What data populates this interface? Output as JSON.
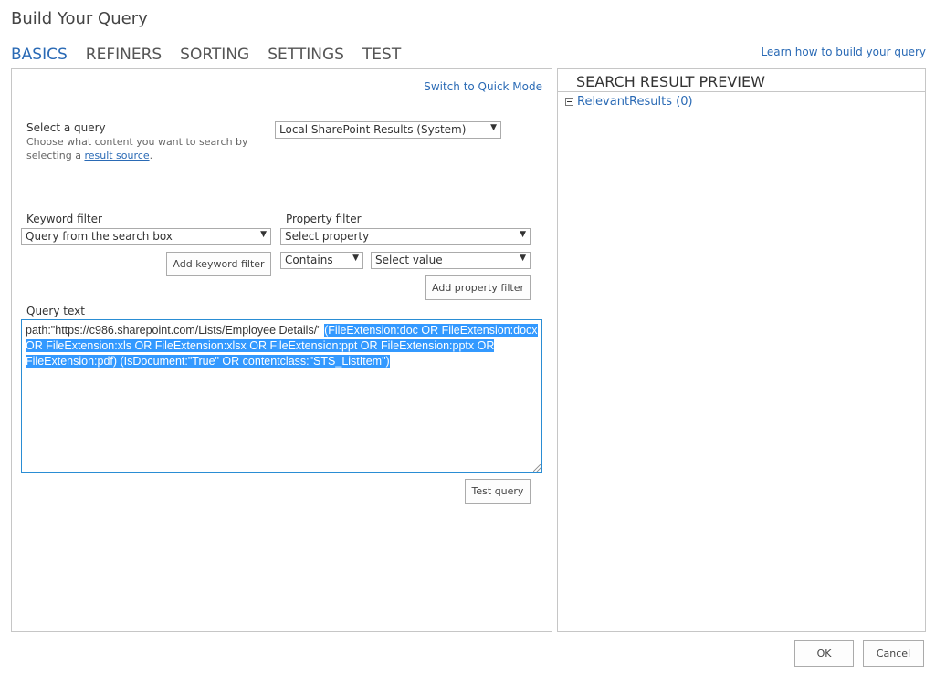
{
  "dialog": {
    "title": "Build Your Query"
  },
  "tabs": [
    {
      "label": "BASICS",
      "active": true
    },
    {
      "label": "REFINERS"
    },
    {
      "label": "SORTING"
    },
    {
      "label": "SETTINGS"
    },
    {
      "label": "TEST"
    }
  ],
  "learn_link": "Learn how to build your query",
  "basics": {
    "switch_mode": "Switch to Quick Mode",
    "select_query": {
      "label": "Select a query",
      "desc_prefix": "Choose what content you want to search by selecting a ",
      "desc_link": "result source",
      "desc_suffix": ".",
      "value": "Local SharePoint Results (System)"
    },
    "keyword_filter": {
      "label": "Keyword filter",
      "value": "Query from the search box",
      "add_button": "Add keyword filter"
    },
    "property_filter": {
      "label": "Property filter",
      "property_value": "Select property",
      "operator_value": "Contains",
      "value_value": "Select value",
      "add_button": "Add property filter"
    },
    "query_text": {
      "label": "Query text",
      "plain_part": "path:\"https://c986.sharepoint.com/Lists/Employee Details/\" ",
      "selected_part": " (FileExtension:doc OR FileExtension:docx OR FileExtension:xls OR FileExtension:xlsx OR FileExtension:ppt OR FileExtension:pptx OR FileExtension:pdf) (IsDocument:\"True\" OR contentclass:\"STS_ListItem\")"
    },
    "test_button": "Test query"
  },
  "preview": {
    "title": "SEARCH RESULT PREVIEW",
    "group_label": "RelevantResults (0)"
  },
  "footer": {
    "ok": "OK",
    "cancel": "Cancel"
  },
  "colors": {
    "accent": "#2a6ab5",
    "selection": "#3399ff",
    "border": "#c6c6c6"
  }
}
